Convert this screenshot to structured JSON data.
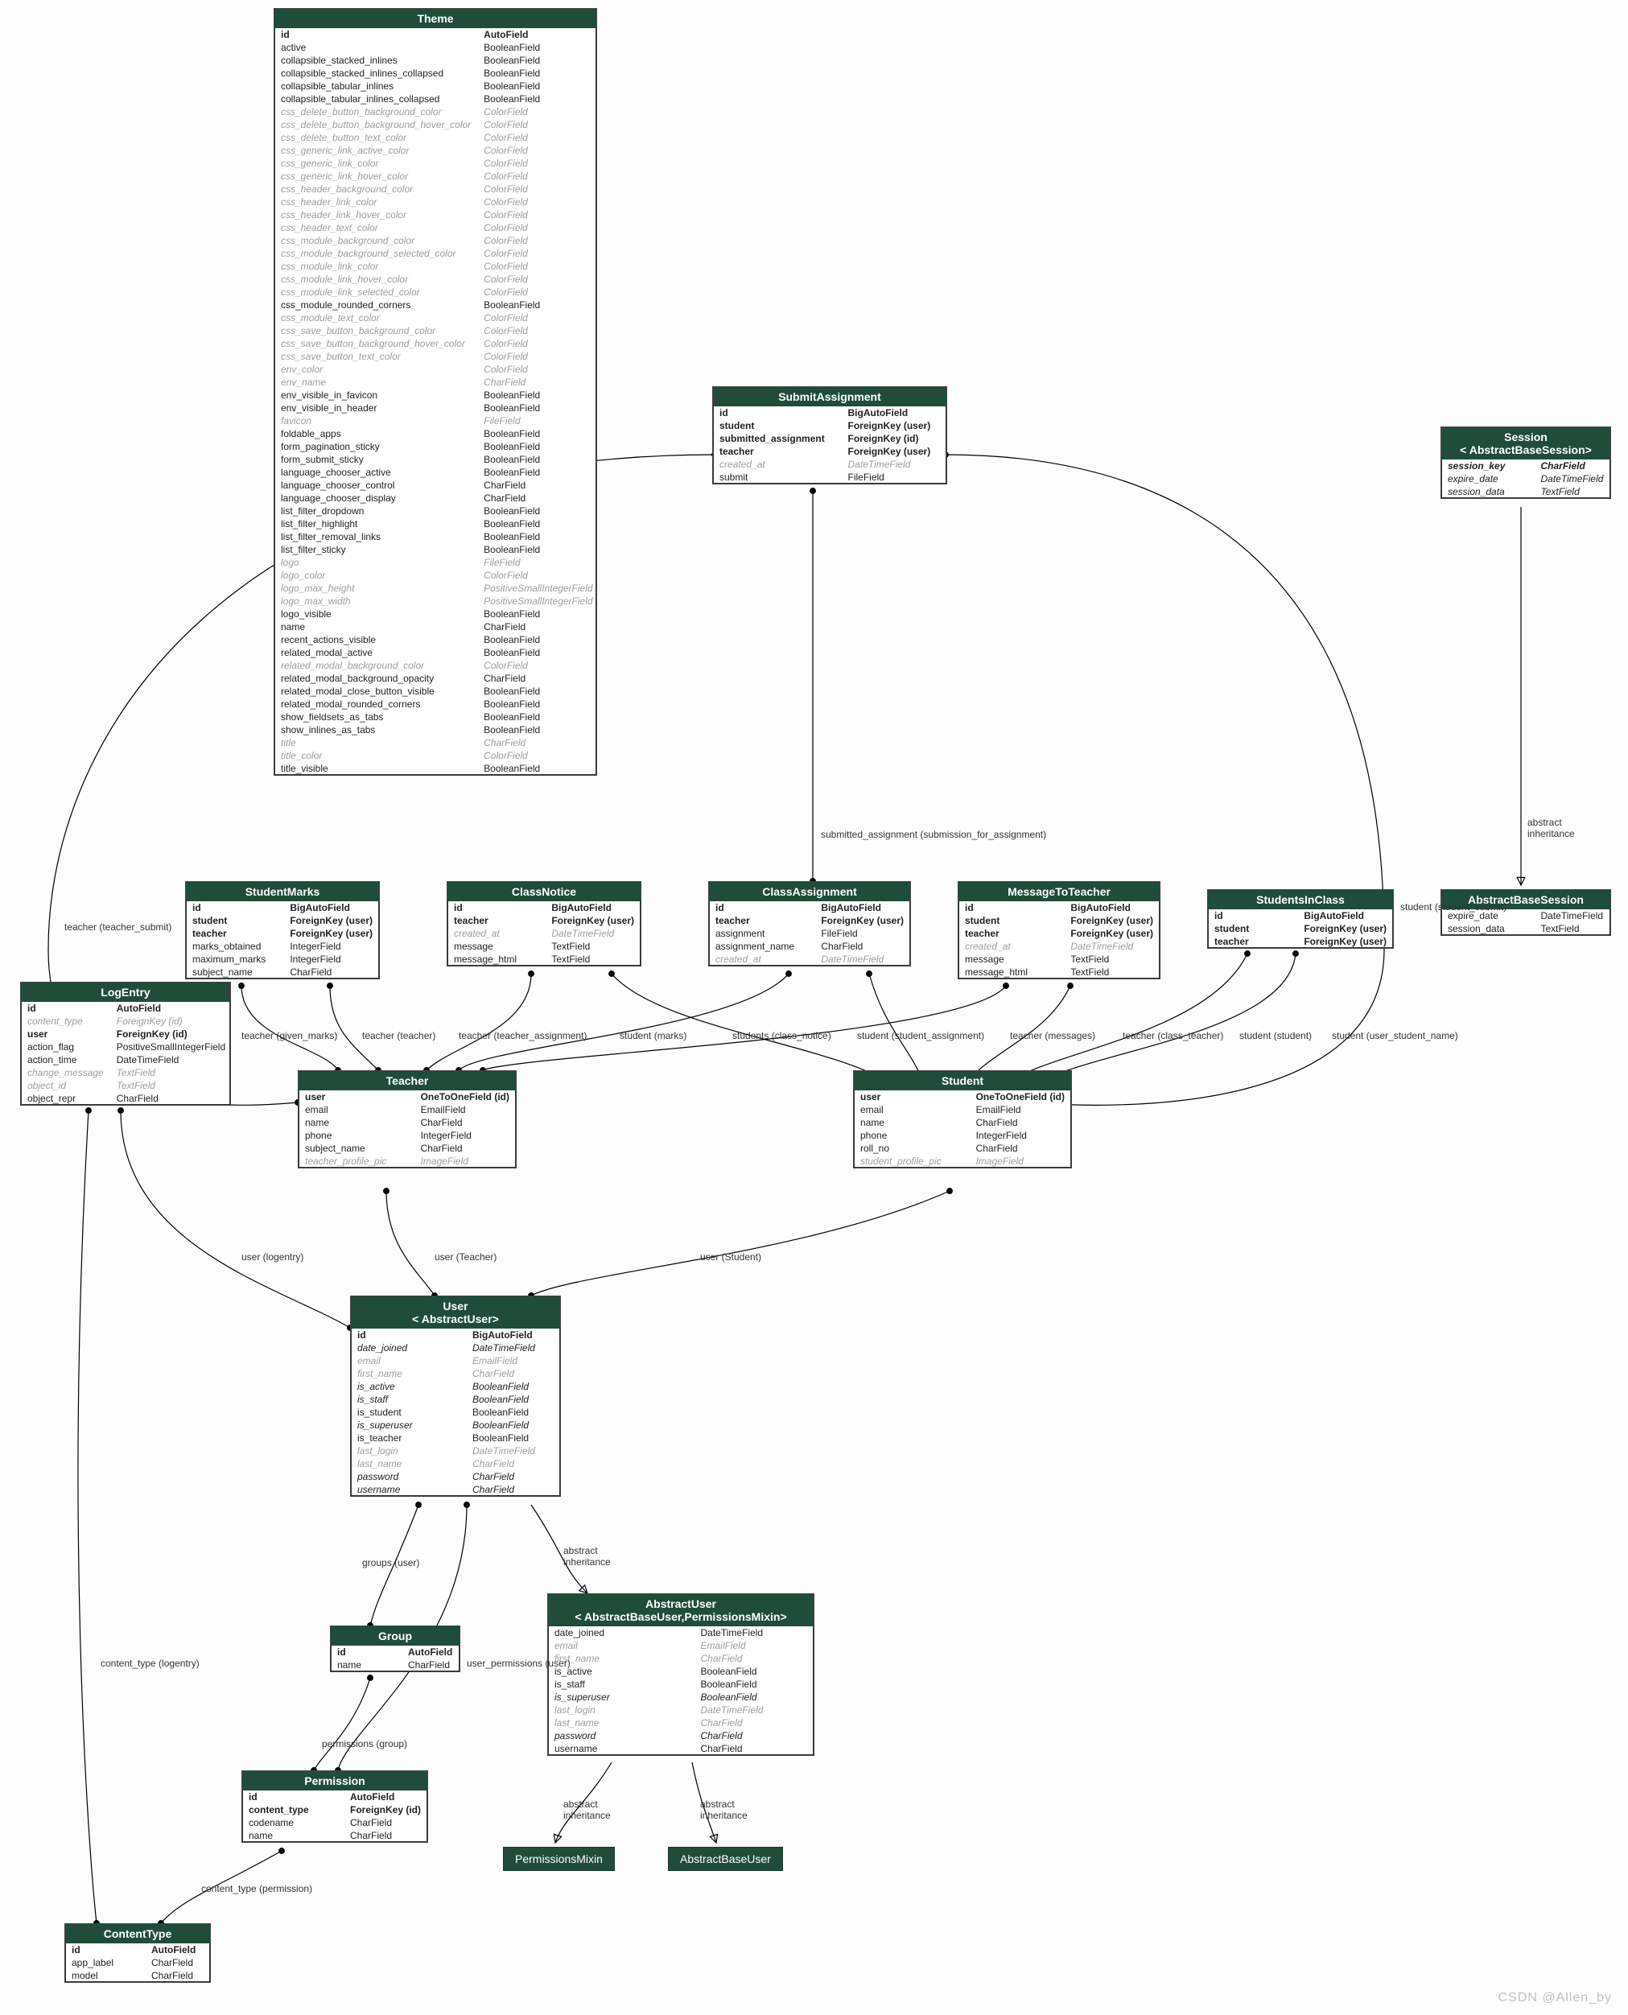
{
  "watermark": "CSDN @Allen_by",
  "labels": {
    "submitted_assignment": "submitted_assignment (submission_for_assignment)",
    "abstract_inheritance1": "abstract\ninheritance",
    "abstract_inheritance2": "abstract\ninheritance",
    "abstract_inheritance3": "abstract\ninheritance",
    "abstract_inheritance4": "abstract\ninheritance",
    "student_student_submit": "student (student_submit)",
    "teacher_teacher_submit": "teacher (teacher_submit)",
    "teacher_given_marks": "teacher (given_marks)",
    "teacher_teacher": "teacher (teacher)",
    "teacher_teacher_assignment": "teacher (teacher_assignment)",
    "student_marks": "student (marks)",
    "students_class_notice": "students (class_notice)",
    "student_student_assignment": "student (student_assignment)",
    "teacher_messages": "teacher (messages)",
    "teacher_class_teacher": "teacher (class_teacher)",
    "student_student": "student (student)",
    "student_user_student_name": "student (user_student_name)",
    "user_logentry": "user (logentry)",
    "user_teacher": "user (Teacher)",
    "user_student": "user (Student)",
    "groups_user": "groups (user)",
    "user_permissions_user": "user_permissions (user)",
    "permissions_group": "permissions (group)",
    "content_type_logentry": "content_type (logentry)",
    "content_type_permission": "content_type (permission)"
  },
  "simple": {
    "permissions_mixin": "PermissionsMixin",
    "abstract_base_user": "AbstractBaseUser",
    "abstract_base_session": "AbstractBaseSession"
  },
  "entities": {
    "Theme": {
      "title": "Theme",
      "rows": [
        [
          "id",
          "AutoField",
          "bold"
        ],
        [
          "active",
          "BooleanField",
          ""
        ],
        [
          "collapsible_stacked_inlines",
          "BooleanField",
          ""
        ],
        [
          "collapsible_stacked_inlines_collapsed",
          "BooleanField",
          ""
        ],
        [
          "collapsible_tabular_inlines",
          "BooleanField",
          ""
        ],
        [
          "collapsible_tabular_inlines_collapsed",
          "BooleanField",
          ""
        ],
        [
          "css_delete_button_background_color",
          "ColorField",
          "dim"
        ],
        [
          "css_delete_button_background_hover_color",
          "ColorField",
          "dim"
        ],
        [
          "css_delete_button_text_color",
          "ColorField",
          "dim"
        ],
        [
          "css_generic_link_active_color",
          "ColorField",
          "dim"
        ],
        [
          "css_generic_link_color",
          "ColorField",
          "dim"
        ],
        [
          "css_generic_link_hover_color",
          "ColorField",
          "dim"
        ],
        [
          "css_header_background_color",
          "ColorField",
          "dim"
        ],
        [
          "css_header_link_color",
          "ColorField",
          "dim"
        ],
        [
          "css_header_link_hover_color",
          "ColorField",
          "dim"
        ],
        [
          "css_header_text_color",
          "ColorField",
          "dim"
        ],
        [
          "css_module_background_color",
          "ColorField",
          "dim"
        ],
        [
          "css_module_background_selected_color",
          "ColorField",
          "dim"
        ],
        [
          "css_module_link_color",
          "ColorField",
          "dim"
        ],
        [
          "css_module_link_hover_color",
          "ColorField",
          "dim"
        ],
        [
          "css_module_link_selected_color",
          "ColorField",
          "dim"
        ],
        [
          "css_module_rounded_corners",
          "BooleanField",
          ""
        ],
        [
          "css_module_text_color",
          "ColorField",
          "dim"
        ],
        [
          "css_save_button_background_color",
          "ColorField",
          "dim"
        ],
        [
          "css_save_button_background_hover_color",
          "ColorField",
          "dim"
        ],
        [
          "css_save_button_text_color",
          "ColorField",
          "dim"
        ],
        [
          "env_color",
          "ColorField",
          "dim"
        ],
        [
          "env_name",
          "CharField",
          "dim"
        ],
        [
          "env_visible_in_favicon",
          "BooleanField",
          ""
        ],
        [
          "env_visible_in_header",
          "BooleanField",
          ""
        ],
        [
          "favicon",
          "FileField",
          "dim"
        ],
        [
          "foldable_apps",
          "BooleanField",
          ""
        ],
        [
          "form_pagination_sticky",
          "BooleanField",
          ""
        ],
        [
          "form_submit_sticky",
          "BooleanField",
          ""
        ],
        [
          "language_chooser_active",
          "BooleanField",
          ""
        ],
        [
          "language_chooser_control",
          "CharField",
          ""
        ],
        [
          "language_chooser_display",
          "CharField",
          ""
        ],
        [
          "list_filter_dropdown",
          "BooleanField",
          ""
        ],
        [
          "list_filter_highlight",
          "BooleanField",
          ""
        ],
        [
          "list_filter_removal_links",
          "BooleanField",
          ""
        ],
        [
          "list_filter_sticky",
          "BooleanField",
          ""
        ],
        [
          "logo",
          "FileField",
          "dim"
        ],
        [
          "logo_color",
          "ColorField",
          "dim"
        ],
        [
          "logo_max_height",
          "PositiveSmallIntegerField",
          "dim"
        ],
        [
          "logo_max_width",
          "PositiveSmallIntegerField",
          "dim"
        ],
        [
          "logo_visible",
          "BooleanField",
          ""
        ],
        [
          "name",
          "CharField",
          ""
        ],
        [
          "recent_actions_visible",
          "BooleanField",
          ""
        ],
        [
          "related_modal_active",
          "BooleanField",
          ""
        ],
        [
          "related_modal_background_color",
          "ColorField",
          "dim"
        ],
        [
          "related_modal_background_opacity",
          "CharField",
          ""
        ],
        [
          "related_modal_close_button_visible",
          "BooleanField",
          ""
        ],
        [
          "related_modal_rounded_corners",
          "BooleanField",
          ""
        ],
        [
          "show_fieldsets_as_tabs",
          "BooleanField",
          ""
        ],
        [
          "show_inlines_as_tabs",
          "BooleanField",
          ""
        ],
        [
          "title",
          "CharField",
          "dim"
        ],
        [
          "title_color",
          "ColorField",
          "dim"
        ],
        [
          "title_visible",
          "BooleanField",
          ""
        ]
      ]
    },
    "SubmitAssignment": {
      "title": "SubmitAssignment",
      "rows": [
        [
          "id",
          "BigAutoField",
          "bold"
        ],
        [
          "student",
          "ForeignKey (user)",
          "bold"
        ],
        [
          "submitted_assignment",
          "ForeignKey (id)",
          "bold"
        ],
        [
          "teacher",
          "ForeignKey (user)",
          "bold"
        ],
        [
          "created_at",
          "DateTimeField",
          "dim"
        ],
        [
          "submit",
          "FileField",
          ""
        ]
      ]
    },
    "Session": {
      "title": "Session\n< AbstractBaseSession>",
      "rows": [
        [
          "session_key",
          "CharField",
          "bold ital"
        ],
        [
          "expire_date",
          "DateTimeField",
          "ital"
        ],
        [
          "session_data",
          "TextField",
          "ital"
        ]
      ]
    },
    "AbstractBaseSession": {
      "title": "AbstractBaseSession",
      "rows": [
        [
          "expire_date",
          "DateTimeField",
          ""
        ],
        [
          "session_data",
          "TextField",
          ""
        ]
      ]
    },
    "StudentMarks": {
      "title": "StudentMarks",
      "rows": [
        [
          "id",
          "BigAutoField",
          "bold"
        ],
        [
          "student",
          "ForeignKey (user)",
          "bold"
        ],
        [
          "teacher",
          "ForeignKey (user)",
          "bold"
        ],
        [
          "marks_obtained",
          "IntegerField",
          ""
        ],
        [
          "maximum_marks",
          "IntegerField",
          ""
        ],
        [
          "subject_name",
          "CharField",
          ""
        ]
      ]
    },
    "ClassNotice": {
      "title": "ClassNotice",
      "rows": [
        [
          "id",
          "BigAutoField",
          "bold"
        ],
        [
          "teacher",
          "ForeignKey (user)",
          "bold"
        ],
        [
          "created_at",
          "DateTimeField",
          "dim"
        ],
        [
          "message",
          "TextField",
          ""
        ],
        [
          "message_html",
          "TextField",
          ""
        ]
      ]
    },
    "ClassAssignment": {
      "title": "ClassAssignment",
      "rows": [
        [
          "id",
          "BigAutoField",
          "bold"
        ],
        [
          "teacher",
          "ForeignKey (user)",
          "bold"
        ],
        [
          "assignment",
          "FileField",
          ""
        ],
        [
          "assignment_name",
          "CharField",
          ""
        ],
        [
          "created_at",
          "DateTimeField",
          "dim"
        ]
      ]
    },
    "MessageToTeacher": {
      "title": "MessageToTeacher",
      "rows": [
        [
          "id",
          "BigAutoField",
          "bold"
        ],
        [
          "student",
          "ForeignKey (user)",
          "bold"
        ],
        [
          "teacher",
          "ForeignKey (user)",
          "bold"
        ],
        [
          "created_at",
          "DateTimeField",
          "dim"
        ],
        [
          "message",
          "TextField",
          ""
        ],
        [
          "message_html",
          "TextField",
          ""
        ]
      ]
    },
    "StudentsInClass": {
      "title": "StudentsInClass",
      "rows": [
        [
          "id",
          "BigAutoField",
          "bold"
        ],
        [
          "student",
          "ForeignKey (user)",
          "bold"
        ],
        [
          "teacher",
          "ForeignKey (user)",
          "bold"
        ]
      ]
    },
    "LogEntry": {
      "title": "LogEntry",
      "rows": [
        [
          "id",
          "AutoField",
          "bold"
        ],
        [
          "content_type",
          "ForeignKey (id)",
          "dim"
        ],
        [
          "user",
          "ForeignKey (id)",
          "bold"
        ],
        [
          "action_flag",
          "PositiveSmallIntegerField",
          ""
        ],
        [
          "action_time",
          "DateTimeField",
          ""
        ],
        [
          "change_message",
          "TextField",
          "dim"
        ],
        [
          "object_id",
          "TextField",
          "dim"
        ],
        [
          "object_repr",
          "CharField",
          ""
        ]
      ]
    },
    "Teacher": {
      "title": "Teacher",
      "rows": [
        [
          "user",
          "OneToOneField (id)",
          "bold"
        ],
        [
          "email",
          "EmailField",
          ""
        ],
        [
          "name",
          "CharField",
          ""
        ],
        [
          "phone",
          "IntegerField",
          ""
        ],
        [
          "subject_name",
          "CharField",
          ""
        ],
        [
          "teacher_profile_pic",
          "ImageField",
          "dim"
        ]
      ]
    },
    "Student": {
      "title": "Student",
      "rows": [
        [
          "user",
          "OneToOneField (id)",
          "bold"
        ],
        [
          "email",
          "EmailField",
          ""
        ],
        [
          "name",
          "CharField",
          ""
        ],
        [
          "phone",
          "IntegerField",
          ""
        ],
        [
          "roll_no",
          "CharField",
          ""
        ],
        [
          "student_profile_pic",
          "ImageField",
          "dim"
        ]
      ]
    },
    "User": {
      "title": "User\n< AbstractUser>",
      "rows": [
        [
          "id",
          "BigAutoField",
          "bold"
        ],
        [
          "date_joined",
          "DateTimeField",
          "ital"
        ],
        [
          "email",
          "EmailField",
          "dim ital"
        ],
        [
          "first_name",
          "CharField",
          "dim ital"
        ],
        [
          "is_active",
          "BooleanField",
          "ital"
        ],
        [
          "is_staff",
          "BooleanField",
          "ital"
        ],
        [
          "is_student",
          "BooleanField",
          ""
        ],
        [
          "is_superuser",
          "BooleanField",
          "ital"
        ],
        [
          "is_teacher",
          "BooleanField",
          ""
        ],
        [
          "last_login",
          "DateTimeField",
          "dim ital"
        ],
        [
          "last_name",
          "CharField",
          "dim ital"
        ],
        [
          "password",
          "CharField",
          "ital"
        ],
        [
          "username",
          "CharField",
          "ital"
        ]
      ]
    },
    "AbstractUser": {
      "title": "AbstractUser\n< AbstractBaseUser,PermissionsMixin>",
      "rows": [
        [
          "date_joined",
          "DateTimeField",
          ""
        ],
        [
          "email",
          "EmailField",
          "dim"
        ],
        [
          "first_name",
          "CharField",
          "dim"
        ],
        [
          "is_active",
          "BooleanField",
          ""
        ],
        [
          "is_staff",
          "BooleanField",
          ""
        ],
        [
          "is_superuser",
          "BooleanField",
          "ital"
        ],
        [
          "last_login",
          "DateTimeField",
          "dim ital"
        ],
        [
          "last_name",
          "CharField",
          "dim"
        ],
        [
          "password",
          "CharField",
          "ital"
        ],
        [
          "username",
          "CharField",
          ""
        ]
      ]
    },
    "Group": {
      "title": "Group",
      "rows": [
        [
          "id",
          "AutoField",
          "bold"
        ],
        [
          "name",
          "CharField",
          ""
        ]
      ]
    },
    "Permission": {
      "title": "Permission",
      "rows": [
        [
          "id",
          "AutoField",
          "bold"
        ],
        [
          "content_type",
          "ForeignKey (id)",
          "bold"
        ],
        [
          "codename",
          "CharField",
          ""
        ],
        [
          "name",
          "CharField",
          ""
        ]
      ]
    },
    "ContentType": {
      "title": "ContentType",
      "rows": [
        [
          "id",
          "AutoField",
          "bold"
        ],
        [
          "app_label",
          "CharField",
          ""
        ],
        [
          "model",
          "CharField",
          ""
        ]
      ]
    }
  }
}
